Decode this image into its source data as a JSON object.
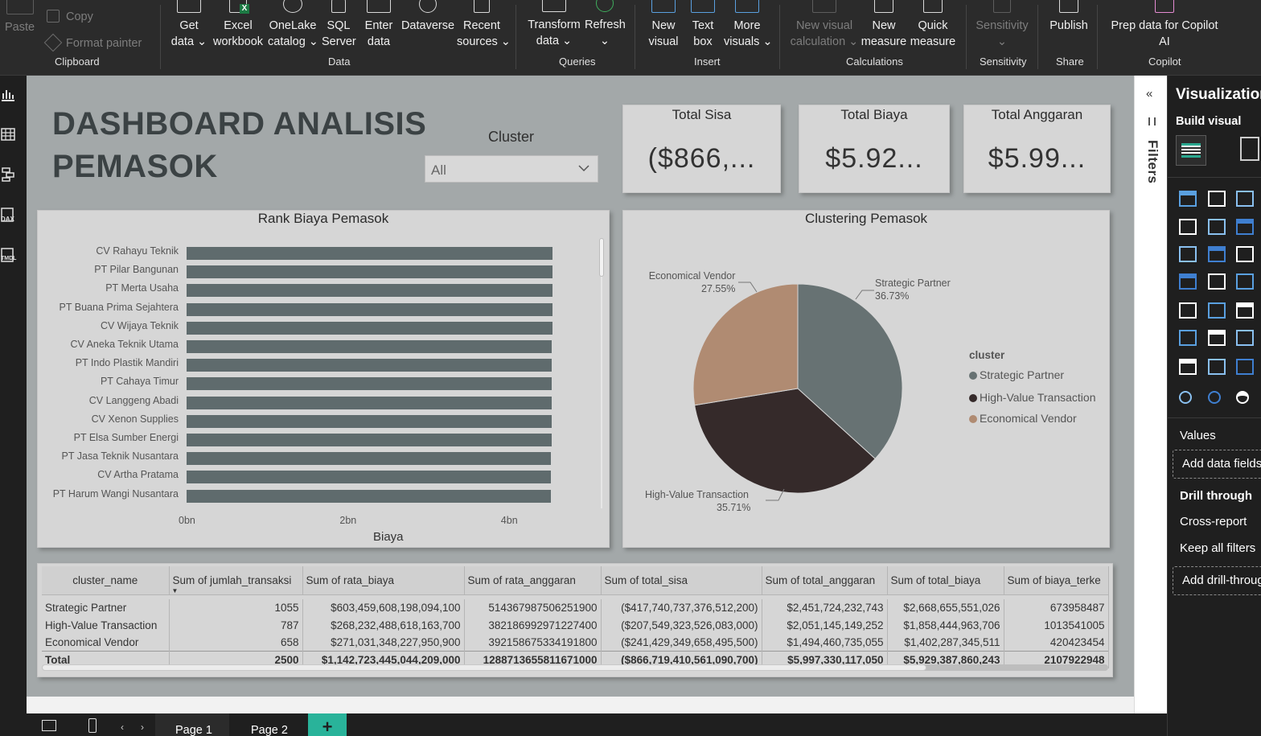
{
  "ribbon": {
    "clipboard": {
      "paste": "Paste",
      "copy": "Copy",
      "format_painter": "Format painter",
      "group": "Clipboard"
    },
    "data": {
      "get_data": [
        "Get",
        "data ⌄"
      ],
      "excel": [
        "Excel",
        "workbook"
      ],
      "onelake": [
        "OneLake",
        "catalog ⌄"
      ],
      "sql": [
        "SQL",
        "Server"
      ],
      "enter": [
        "Enter",
        "data"
      ],
      "dataverse": "Dataverse",
      "recent": [
        "Recent",
        "sources ⌄"
      ],
      "group": "Data"
    },
    "queries": {
      "transform": [
        "Transform",
        "data ⌄"
      ],
      "refresh": "Refresh",
      "refresh_chev": "⌄",
      "group": "Queries"
    },
    "insert": {
      "new_visual": [
        "New",
        "visual"
      ],
      "text_box": [
        "Text",
        "box"
      ],
      "more_visuals": [
        "More",
        "visuals ⌄"
      ],
      "group": "Insert"
    },
    "calculations": {
      "new_visual_calc": [
        "New visual",
        "calculation ⌄"
      ],
      "new_measure": [
        "New",
        "measure"
      ],
      "quick_measure": [
        "Quick",
        "measure"
      ],
      "group": "Calculations"
    },
    "sensitivity": {
      "label": "Sensitivity",
      "chev": "⌄",
      "group": "Sensitivity"
    },
    "share": {
      "publish": "Publish",
      "group": "Share"
    },
    "copilot": {
      "prep": [
        "Prep data for Copilot",
        "AI"
      ],
      "group": "Copilot"
    }
  },
  "leftnav": {
    "dax_label": "DAX",
    "tmdl_label": "TMDL"
  },
  "dashboard": {
    "title_line1": "DASHBOARD ANALISIS",
    "title_line2": "PEMASOK",
    "slicer": {
      "label": "Cluster",
      "value": "All"
    },
    "cards": [
      {
        "label": "Total Sisa",
        "value": "($866,..."
      },
      {
        "label": "Total Biaya",
        "value": "$5.92..."
      },
      {
        "label": "Total Anggaran",
        "value": "$5.99..."
      }
    ]
  },
  "colors": {
    "bar": "#5f6b6d",
    "strategic": "#677273",
    "high_value": "#352a2a",
    "economical": "#b08b72",
    "accent": "#29b39a"
  },
  "chart_data": [
    {
      "type": "bar",
      "title": "Rank Biaya Pemasok",
      "xlabel": "Biaya",
      "ylabel": "",
      "categories": [
        "CV Rahayu Teknik",
        "PT Pilar Bangunan",
        "PT Merta Usaha",
        "PT Buana Prima Sejahtera",
        "CV Wijaya Teknik",
        "CV Aneka Teknik Utama",
        "PT Indo Plastik Mandiri",
        "PT Cahaya Timur",
        "CV Langgeng Abadi",
        "CV Xenon Supplies",
        "PT Elsa Sumber Energi",
        "PT Jasa Teknik Nusantara",
        "CV Artha Pratama",
        "PT Harum Wangi Nusantara"
      ],
      "values": [
        5.0,
        5.0,
        5.0,
        4.99,
        4.99,
        4.98,
        4.98,
        4.98,
        4.98,
        4.98,
        4.98,
        4.97,
        4.97,
        4.97
      ],
      "xticks": [
        "0bn",
        "2bn",
        "4bn"
      ],
      "xlim": [
        0,
        5.5
      ],
      "grid": false
    },
    {
      "type": "pie",
      "title": "Clustering Pemasok",
      "legend_title": "cluster",
      "legend_position": "right",
      "slices": [
        {
          "name": "Strategic Partner",
          "value": 36.73,
          "label": "36.73%",
          "color": "#677273"
        },
        {
          "name": "High-Value Transaction",
          "value": 35.71,
          "label": "35.71%",
          "color": "#352a2a"
        },
        {
          "name": "Economical Vendor",
          "value": 27.55,
          "label": "27.55%",
          "color": "#b08b72"
        }
      ]
    }
  ],
  "table": {
    "headers": [
      "cluster_name",
      "Sum of jumlah_transaksi",
      "Sum of rata_biaya",
      "Sum of rata_anggaran",
      "Sum of total_sisa",
      "Sum of total_anggaran",
      "Sum of total_biaya",
      "Sum of biaya_terke"
    ],
    "sort_indicator": "▼",
    "rows": [
      [
        "Strategic Partner",
        "1055",
        "$603,459,608,198,094,100",
        "514367987506251900",
        "($417,740,737,376,512,200)",
        "$2,451,724,232,743",
        "$2,668,655,551,026",
        "673958487"
      ],
      [
        "High-Value Transaction",
        "787",
        "$268,232,488,618,163,700",
        "382186992971227400",
        "($207,549,323,526,083,000)",
        "$2,051,145,149,252",
        "$1,858,444,963,706",
        "1013541005"
      ],
      [
        "Economical Vendor",
        "658",
        "$271,031,348,227,950,900",
        "392158675334191800",
        "($241,429,349,658,495,500)",
        "$1,494,460,735,055",
        "$1,402,287,345,511",
        "420423454"
      ]
    ],
    "total": [
      "Total",
      "2500",
      "$1,142,723,445,044,209,000",
      "1288713655811671000",
      "($866,719,410,561,090,700)",
      "$5,997,330,117,050",
      "$5,929,387,860,243",
      "2107922948"
    ]
  },
  "filters": {
    "label": "Filters"
  },
  "vizpane": {
    "title": "Visualization",
    "build_visual": "Build visual",
    "values": "Values",
    "add_data_fields": "Add data fields",
    "drill_through": "Drill through",
    "cross_report": "Cross-report",
    "keep_all_filters": "Keep all filters",
    "add_drill_through": "Add drill-through"
  },
  "pages": {
    "tabs": [
      "Page 1",
      "Page 2"
    ],
    "add": "+"
  }
}
